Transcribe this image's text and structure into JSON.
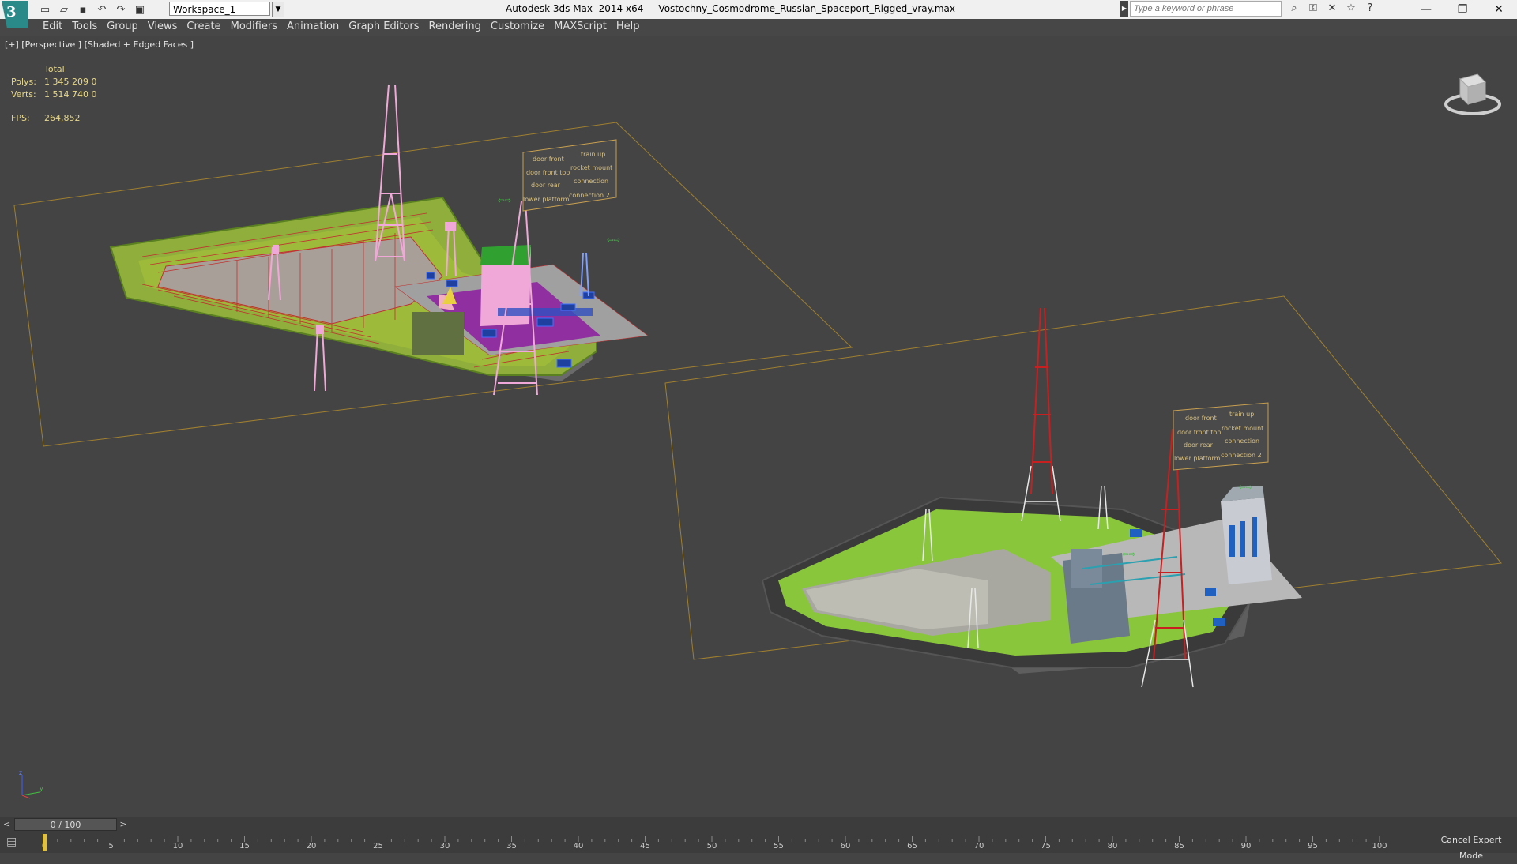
{
  "titlebar": {
    "app_logo_letter": "3",
    "workspace": "Workspace_1",
    "title": "Autodesk 3ds Max  2014 x64     Vostochny_Cosmodrome_Russian_Spaceport_Rigged_vray.max",
    "search_placeholder": "Type a keyword or phrase",
    "quick_access_icons": [
      "new-file-icon",
      "open-folder-icon",
      "save-icon",
      "undo-icon",
      "redo-icon",
      "project-folder-icon"
    ],
    "info_icons": [
      "binoculars-icon",
      "key-icon",
      "communication-icon",
      "star-icon",
      "help-icon"
    ]
  },
  "menu": {
    "items": [
      "Edit",
      "Tools",
      "Group",
      "Views",
      "Create",
      "Modifiers",
      "Animation",
      "Graph Editors",
      "Rendering",
      "Customize",
      "MAXScript",
      "Help"
    ]
  },
  "viewport": {
    "label": "[+] [Perspective ] [Shaded + Edged Faces ]",
    "stats": {
      "header": "Total",
      "polys_label": "Polys:",
      "polys_value": "1 345 209  0",
      "verts_label": "Verts:",
      "verts_value": "1 514 740  0",
      "fps_label": "FPS:",
      "fps_value": "264,852"
    },
    "rig_labels": [
      "door front",
      "train up",
      "door front top",
      "rocket mount",
      "door rear",
      "connection",
      "lower platform",
      "connection 2"
    ],
    "viewcube_label": "FRONT"
  },
  "timeline": {
    "frame_display": "0 / 100",
    "prev": "<",
    "next": ">",
    "ticks": [
      "0",
      "5",
      "10",
      "15",
      "20",
      "25",
      "30",
      "35",
      "40",
      "45",
      "50",
      "55",
      "60",
      "65",
      "70",
      "75",
      "80",
      "85",
      "90",
      "95",
      "100"
    ],
    "cancel_expert_label": "Cancel Expert Mode"
  },
  "colors": {
    "viewport_bg": "#444444",
    "grid_line": "#a08030",
    "stats_text": "#e8d88a",
    "grass": "#8ac63c",
    "wire_red": "#c03030",
    "tower_pink": "#f0a8d8",
    "tower_red": "#c82020"
  }
}
